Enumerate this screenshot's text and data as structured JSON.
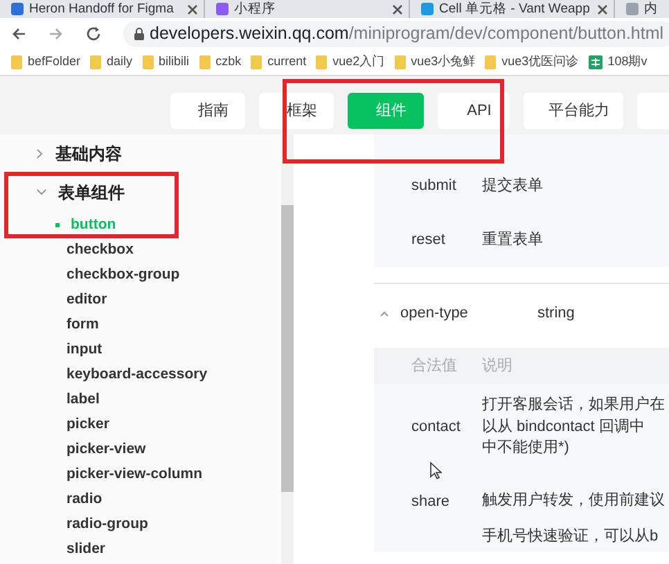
{
  "browser": {
    "tabs": [
      {
        "title": "Heron Handoff for Figma"
      },
      {
        "title": "小程序"
      },
      {
        "title": "Cell 单元格 - Vant Weapp"
      },
      {
        "title": "内"
      }
    ],
    "url": {
      "domain": "developers.weixin.qq.com",
      "path": "/miniprogram/dev/component/button.html"
    },
    "bookmarks": [
      {
        "label": "befFolder",
        "kind": "folder"
      },
      {
        "label": "daily",
        "kind": "folder"
      },
      {
        "label": "bilibili",
        "kind": "folder"
      },
      {
        "label": "czbk",
        "kind": "folder"
      },
      {
        "label": "current",
        "kind": "folder"
      },
      {
        "label": "vue2入门",
        "kind": "folder"
      },
      {
        "label": "vue3小兔鲜",
        "kind": "folder"
      },
      {
        "label": "vue3优医问诊",
        "kind": "folder"
      },
      {
        "label": "108期v",
        "kind": "sheet"
      }
    ]
  },
  "nav": [
    {
      "label": "指南",
      "selected": false
    },
    {
      "label": "框架",
      "selected": false
    },
    {
      "label": "组件",
      "selected": true
    },
    {
      "label": "API",
      "selected": false
    },
    {
      "label": "平台能力",
      "selected": false
    },
    {
      "selected": false
    }
  ],
  "sidebar": {
    "items": [
      {
        "label": "基础内容",
        "expanded": false
      },
      {
        "label": "表单组件",
        "expanded": true,
        "children": [
          {
            "label": "button",
            "selected": true
          },
          {
            "label": "checkbox",
            "selected": false
          },
          {
            "label": "checkbox-group",
            "selected": false
          },
          {
            "label": "editor",
            "selected": false
          },
          {
            "label": "form",
            "selected": false
          },
          {
            "label": "input",
            "selected": false
          },
          {
            "label": "keyboard-accessory",
            "selected": false
          },
          {
            "label": "label",
            "selected": false
          },
          {
            "label": "picker",
            "selected": false
          },
          {
            "label": "picker-view",
            "selected": false
          },
          {
            "label": "picker-view-column",
            "selected": false
          },
          {
            "label": "radio",
            "selected": false
          },
          {
            "label": "radio-group",
            "selected": false
          },
          {
            "label": "slider",
            "selected": false
          }
        ]
      }
    ]
  },
  "content": {
    "form_type_rows": [
      {
        "value": "submit",
        "description": "提交表单"
      },
      {
        "value": "reset",
        "description": "重置表单"
      }
    ],
    "property": {
      "name": "open-type",
      "type": "string",
      "expanded": true
    },
    "table": {
      "columns": [
        "合法值",
        "说明"
      ],
      "rows": [
        {
          "value": "contact",
          "description": [
            "打开客服会话，如果用户在",
            "以从 bindcontact 回调中",
            "中不能使用*)"
          ]
        },
        {
          "value": "share",
          "description": [
            "触发用户转发，使用前建议"
          ]
        },
        {
          "description": [
            "手机号快速验证，可以从b"
          ]
        }
      ]
    }
  }
}
